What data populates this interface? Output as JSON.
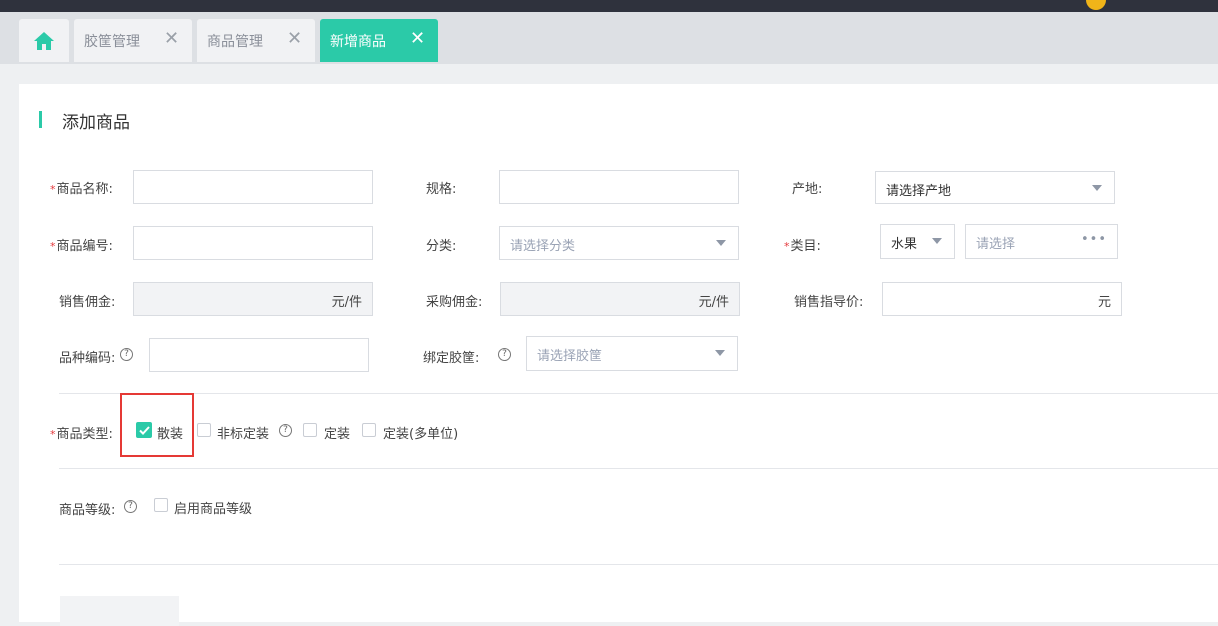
{
  "tabs": [
    {
      "label": "",
      "icon": "home-icon",
      "active": false
    },
    {
      "label": "胶筐管理",
      "active": false
    },
    {
      "label": "商品管理",
      "active": false
    },
    {
      "label": "新增商品",
      "active": true
    }
  ],
  "section_title": "添加商品",
  "form": {
    "name": {
      "label": "商品名称:",
      "required": true,
      "value": ""
    },
    "spec": {
      "label": "规格:",
      "value": ""
    },
    "origin": {
      "label": "产地:",
      "placeholder": "请选择产地"
    },
    "code": {
      "label": "商品编号:",
      "required": true,
      "value": ""
    },
    "category": {
      "label": "分类:",
      "placeholder": "请选择分类"
    },
    "item_class": {
      "label": "类目:",
      "required": true,
      "selected": "水果",
      "placeholder": "请选择"
    },
    "sales_commission": {
      "label": "销售佣金:",
      "unit": "元/件"
    },
    "purchase_commission": {
      "label": "采购佣金:",
      "unit": "元/件"
    },
    "guide_price": {
      "label": "销售指导价:",
      "unit": "元"
    },
    "variety_code": {
      "label": "品种编码:",
      "value": ""
    },
    "bind_basket": {
      "label": "绑定胶筐:",
      "placeholder": "请选择胶筐"
    },
    "goods_type": {
      "label": "商品类型:",
      "required": true,
      "options": [
        {
          "label": "散装",
          "checked": true
        },
        {
          "label": "非标定装",
          "checked": false
        },
        {
          "label": "定装",
          "checked": false
        },
        {
          "label": "定装(多单位)",
          "checked": false
        }
      ]
    },
    "goods_grade": {
      "label": "商品等级:",
      "option": "启用商品等级",
      "checked": false
    }
  },
  "colors": {
    "accent": "#2bcaa8",
    "required": "#e4393c",
    "highlight": "#e53935"
  }
}
